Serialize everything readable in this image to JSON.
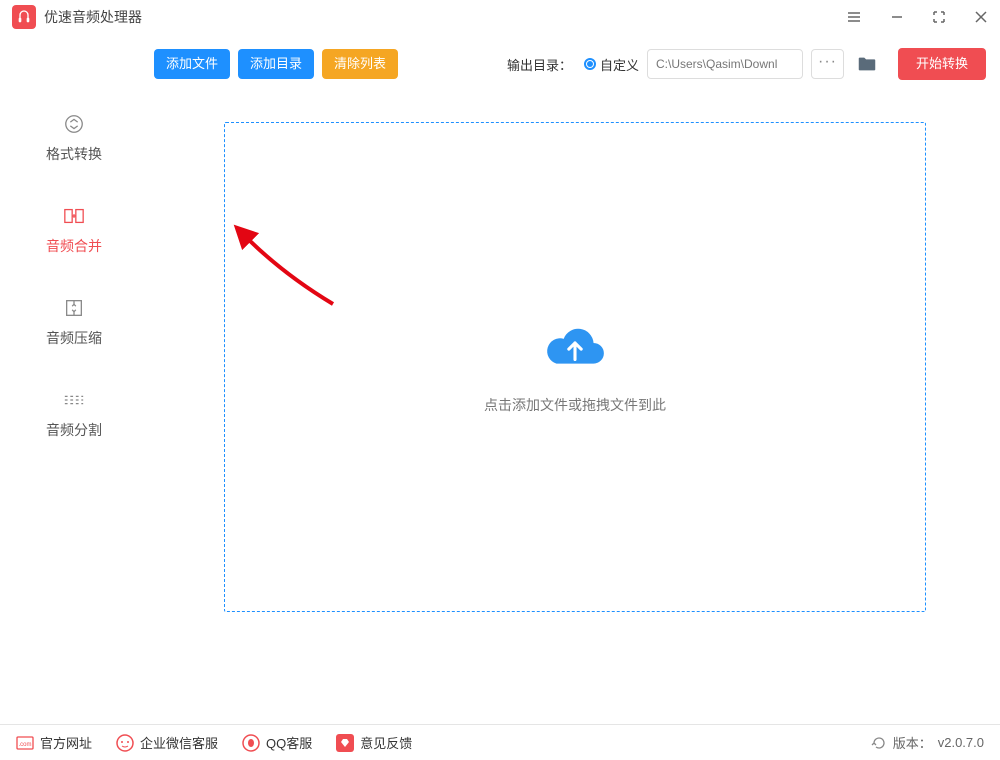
{
  "app": {
    "title": "优速音频处理器"
  },
  "toolbar": {
    "add_file": "添加文件",
    "add_dir": "添加目录",
    "clear_list": "清除列表",
    "output_label": "输出目录：",
    "custom_label": "自定义",
    "path": "C:\\Users\\Qasim\\Downl",
    "start": "开始转换"
  },
  "sidebar": {
    "items": [
      {
        "label": "格式转换"
      },
      {
        "label": "音频合并"
      },
      {
        "label": "音频压缩"
      },
      {
        "label": "音频分割"
      }
    ]
  },
  "dropzone": {
    "text": "点击添加文件或拖拽文件到此"
  },
  "footer": {
    "site": "官方网址",
    "wechat": "企业微信客服",
    "qq": "QQ客服",
    "feedback": "意见反馈",
    "version_label": "版本：",
    "version": "v2.0.7.0"
  }
}
